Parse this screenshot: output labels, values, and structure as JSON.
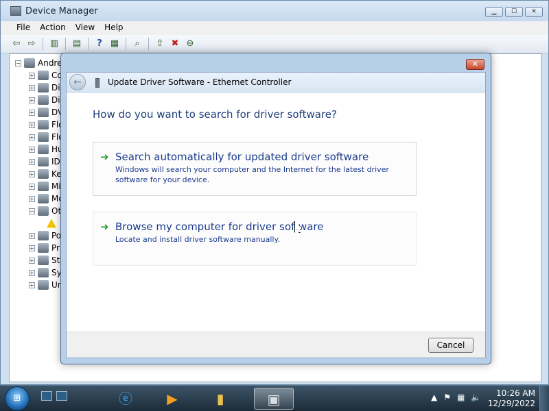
{
  "device_manager": {
    "title": "Device Manager",
    "window_controls": [
      "▁",
      "☐",
      "✕"
    ],
    "menu": [
      "File",
      "Action",
      "View",
      "Help"
    ],
    "toolbar_icons": [
      "back-icon",
      "forward-icon",
      "show-hide-console-tree-icon",
      "properties-icon",
      "help-icon",
      "view-icon",
      "scan-hardware-icon",
      "update-driver-icon",
      "disable-device-icon",
      "uninstall-icon"
    ],
    "tree": {
      "root": "Andre",
      "items": [
        "Co",
        "Di",
        "Di",
        "DV",
        "Flo",
        "Flo",
        "Hu",
        "ID",
        "Ke",
        "Mi",
        "Mo",
        "Ot",
        "",
        "Po",
        "Pr",
        "St",
        "Sy",
        "Ur"
      ]
    }
  },
  "dialog": {
    "title": "Update Driver Software - Ethernet Controller",
    "question": "How do you want to search for driver software?",
    "options": [
      {
        "title": "Search automatically for updated driver software",
        "description": "Windows will search your computer and the Internet for the latest driver software for your device."
      },
      {
        "title": "Browse my computer for driver software",
        "description": "Locate and install driver software manually."
      }
    ],
    "cancel_label": "Cancel"
  },
  "taskbar": {
    "clock_time": "10:26 AM",
    "clock_date": "12/29/2022",
    "tray_icons": [
      "show-hidden-icons-icon",
      "action-center-icon",
      "network-icon",
      "volume-muted-icon"
    ],
    "pinned": [
      "internet-explorer-icon",
      "media-player-icon",
      "windows-explorer-icon",
      "device-manager-icon"
    ]
  },
  "colors": {
    "link_blue": "#1a3a8c",
    "heading_blue": "#1e3f7a",
    "arrow_green": "#2b9d2b",
    "close_red": "#c8462c"
  }
}
